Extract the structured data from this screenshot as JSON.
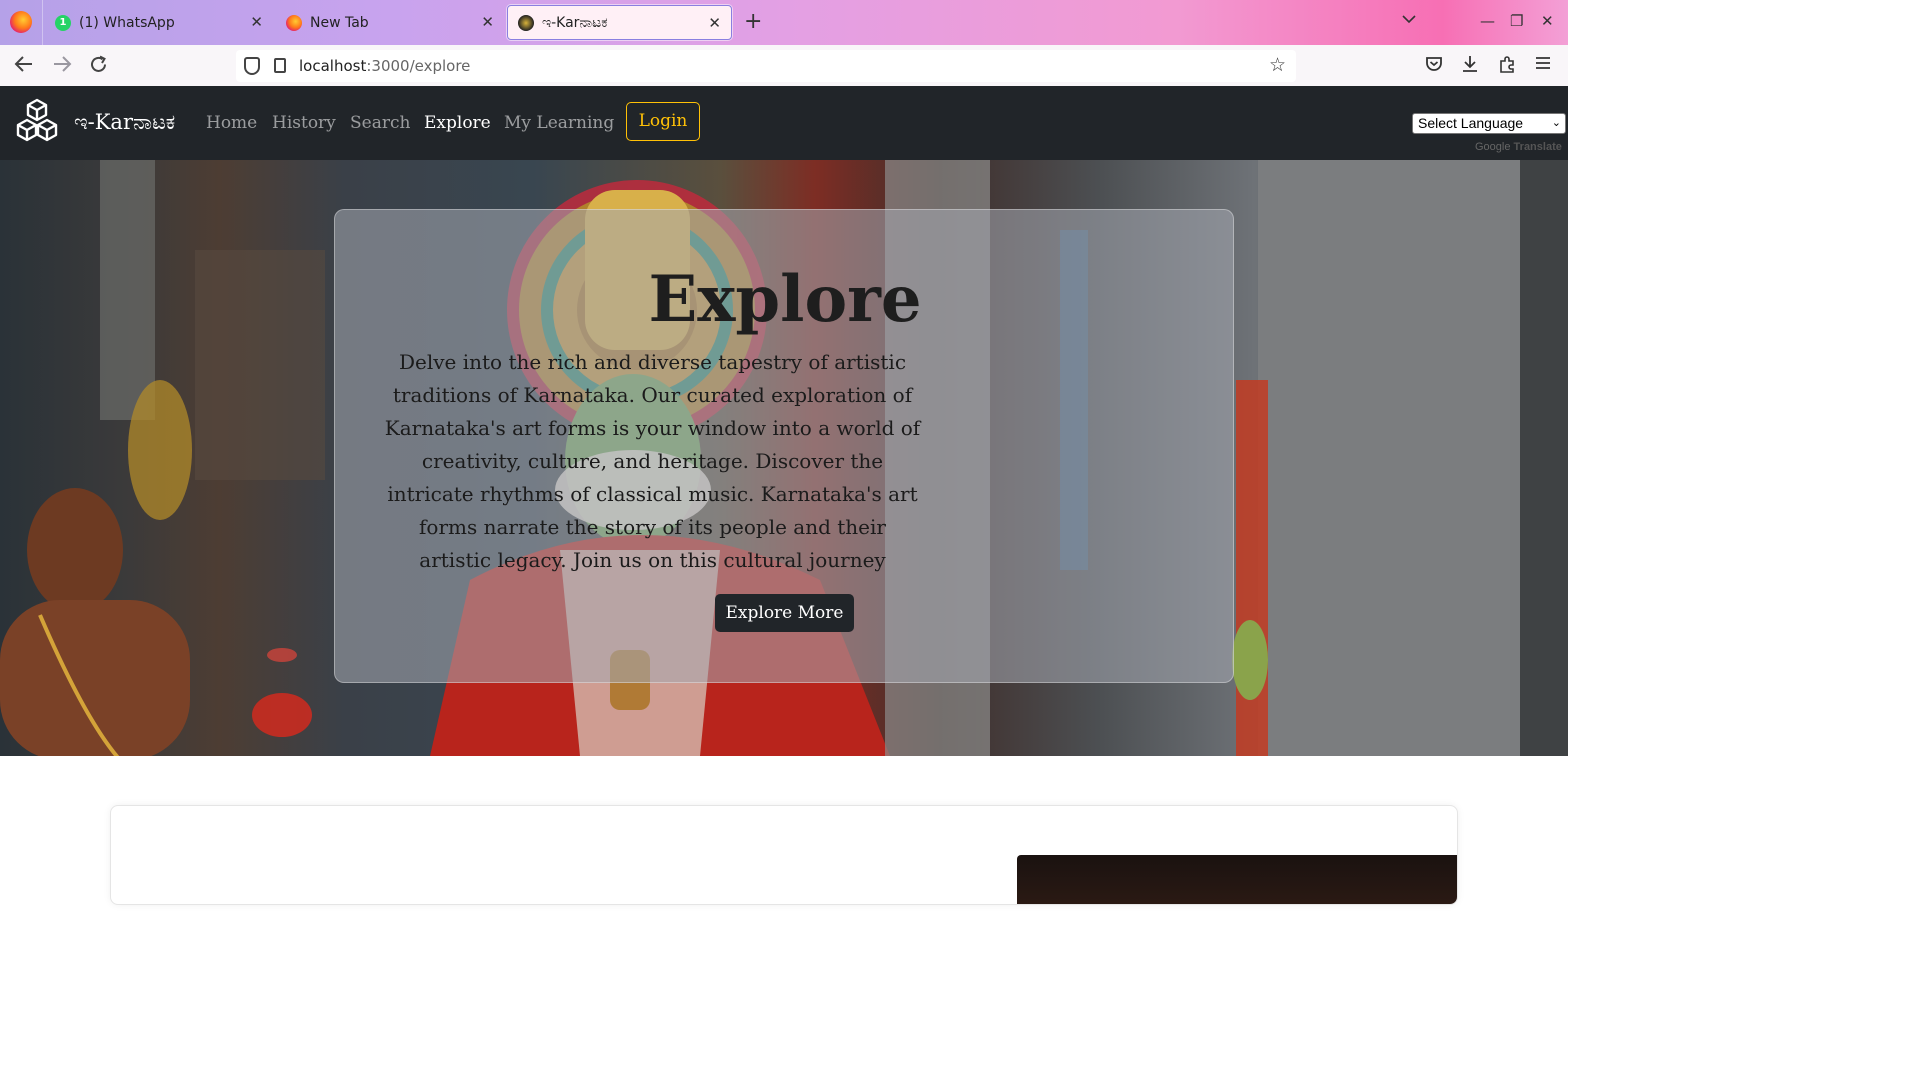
{
  "browser": {
    "tabs": [
      {
        "title": "(1) WhatsApp",
        "favicon": "whatsapp-icon",
        "active": false
      },
      {
        "title": "New Tab",
        "favicon": "firefox-icon",
        "active": false
      },
      {
        "title": "ಇ-Karನಾಟಕ",
        "favicon": "site-icon",
        "active": true
      }
    ],
    "url_host": "localhost",
    "url_path": ":3000/explore",
    "whatsapp_badge": "1"
  },
  "site": {
    "brand": "ಇ-Karನಾಟಕ",
    "nav": {
      "home": "Home",
      "history": "History",
      "search": "Search",
      "explore": "Explore",
      "my_learning": "My Learning",
      "login": "Login"
    },
    "language": {
      "select_label": "Select Language",
      "google": "Google",
      "translate": "Translate"
    },
    "colors": {
      "navbar": "#212529",
      "login_accent": "#ffc107"
    }
  },
  "hero": {
    "title": "Explore",
    "text": "Delve into the rich and diverse tapestry of artistic traditions of Karnataka. Our curated exploration of Karnataka's art forms is your window into a world of creativity, culture, and heritage. Discover the intricate rhythms of classical music. Karnataka's art forms narrate the story of its people and their artistic legacy. Join us on this cultural journey",
    "button": "Explore More"
  }
}
